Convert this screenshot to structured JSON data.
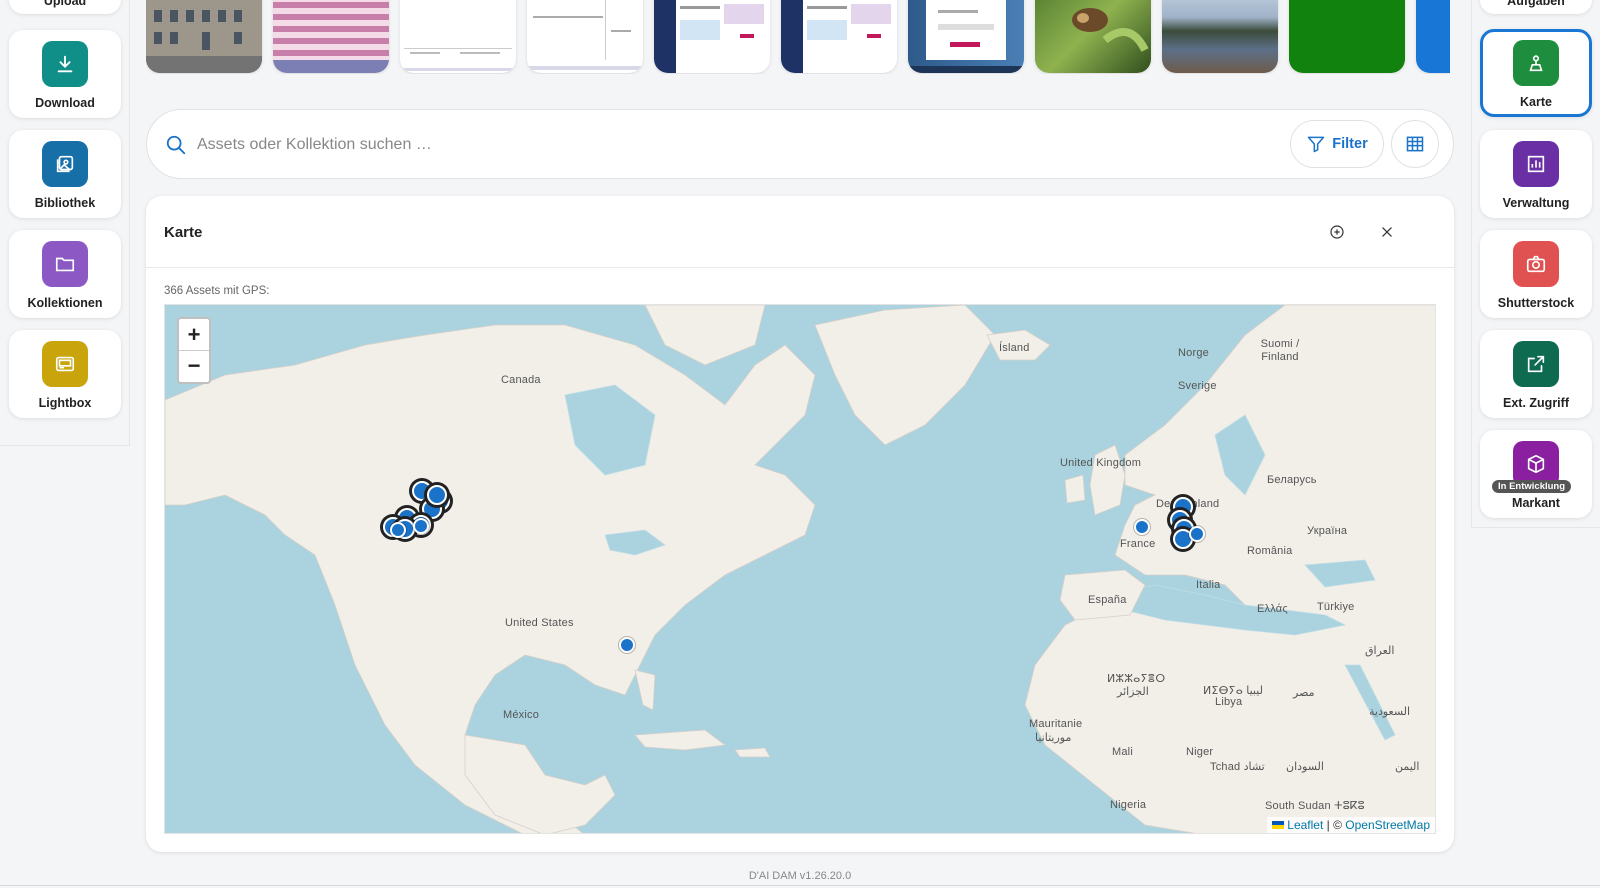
{
  "left_rail": {
    "items": [
      {
        "label": "Upload",
        "icon": "upload-icon"
      },
      {
        "label": "Download",
        "icon": "download-icon",
        "color": "#0f8f87"
      },
      {
        "label": "Bibliothek",
        "icon": "library-icon",
        "color": "#176fa8"
      },
      {
        "label": "Kollektionen",
        "icon": "folder-icon",
        "color": "#8b58c4"
      },
      {
        "label": "Lightbox",
        "icon": "lightbox-icon",
        "color": "#c9a40a"
      }
    ]
  },
  "right_rail": {
    "items": [
      {
        "label": "Aufgaben",
        "icon": "tasks-icon"
      },
      {
        "label": "Karte",
        "icon": "map-icon",
        "color": "#1e8e3e",
        "active": true
      },
      {
        "label": "Verwaltung",
        "icon": "chart-icon",
        "color": "#6a2fa5"
      },
      {
        "label": "Shutterstock",
        "icon": "camera-icon",
        "color": "#e05252"
      },
      {
        "label": "Ext. Zugriff",
        "icon": "share-icon",
        "color": "#0e6b50"
      },
      {
        "label": "Markant",
        "icon": "box-icon",
        "color": "#8a1fa0",
        "badge": "In Entwicklung"
      }
    ]
  },
  "search": {
    "placeholder": "Assets oder Kollektion suchen …",
    "filter_label": "Filter"
  },
  "map_panel": {
    "title": "Karte",
    "gps_count": "366 Assets mit GPS:",
    "zoom_in": "+",
    "zoom_out": "−",
    "attribution": {
      "leaflet": "Leaflet",
      "sep": "| ©",
      "osm": "OpenStreetMap"
    },
    "labels": [
      "Canada",
      "Ísland",
      "Norge",
      "Sverige",
      "Suomi / Finland",
      "United Kingdom",
      "Беларусь",
      "Deutschland",
      "France",
      "Україна",
      "România",
      "Italia",
      "España",
      "Ελλάς",
      "Türkiye",
      "United States",
      "México",
      "العراق",
      "ⵍⵣⵣⴰⵢⴻⵔ",
      "الجزائر",
      "ⵍⵉⴱⵢⴰ ليبيا",
      "Libya",
      "مصر",
      "السعودية",
      "Mauritanie",
      "موريتانيا",
      "Mali",
      "Niger",
      "Tchad تشاد",
      "السودان",
      "Nigeria",
      "South Sudan ⵜⵓⴽⵓ",
      "اليمن"
    ]
  },
  "footer": {
    "version": "D'AI DAM v1.26.20.0"
  }
}
